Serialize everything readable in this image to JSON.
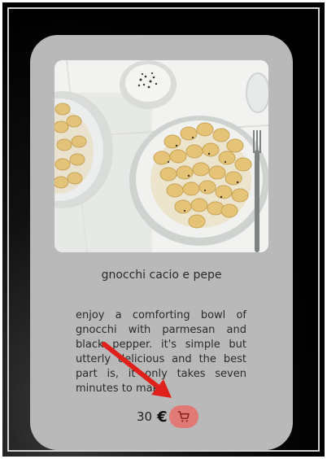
{
  "product": {
    "title": "gnocchi cacio e pepe",
    "description": "enjoy a comforting bowl of gnocchi with parmesan and black pepper. it's simple but utterly delicious and the best part is, it only takes seven minutes to make.",
    "price": "30",
    "currency": "€"
  },
  "icons": {
    "cart": "shopping-cart-icon",
    "annotation": "red-arrow"
  },
  "colors": {
    "card_background": "#b9b9b9",
    "cart_button": "#e07a76",
    "arrow": "#e0201a"
  }
}
